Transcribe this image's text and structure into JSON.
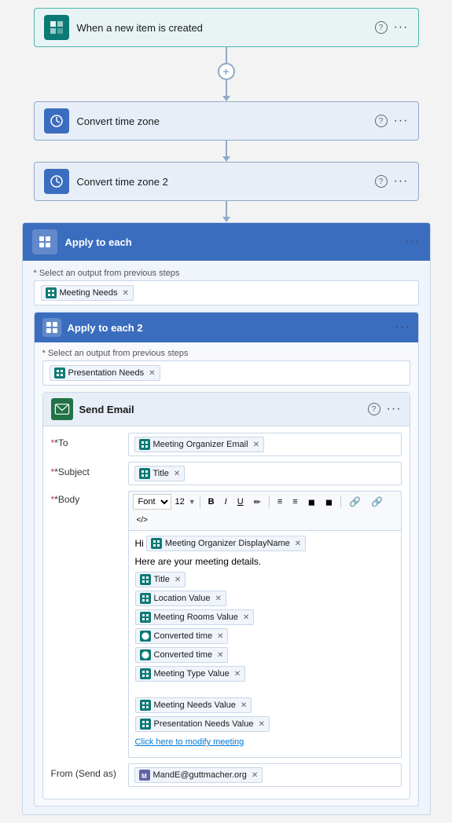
{
  "steps": [
    {
      "id": "trigger",
      "type": "trigger",
      "icon": "sharepoint",
      "label": "When a new item is created"
    },
    {
      "id": "convert-tz-1",
      "type": "action",
      "icon": "clock",
      "label": "Convert time zone"
    },
    {
      "id": "convert-tz-2",
      "type": "action",
      "icon": "clock",
      "label": "Convert time zone 2"
    }
  ],
  "apply_each": {
    "label": "Apply to each",
    "output_label": "* Select an output from previous steps",
    "token": "Meeting Needs",
    "inner": {
      "label": "Apply to each 2",
      "output_label": "* Select an output from previous steps",
      "token": "Presentation Needs",
      "email": {
        "label": "Send Email",
        "help": "?",
        "to_label": "*To",
        "to_token": "Meeting Organizer Email",
        "subject_label": "*Subject",
        "subject_token": "Title",
        "body_label": "*Body",
        "toolbar": {
          "font_label": "Font",
          "font_size": "12",
          "buttons": [
            "B",
            "I",
            "U",
            "✏",
            "≡",
            "≡",
            "◼",
            "◼",
            "🔗",
            "🔗",
            "</>"
          ]
        },
        "body_greeting": "Hi",
        "body_organizer_token": "Meeting Organizer DisplayName",
        "body_text1": "Here are your meeting details.",
        "body_tokens": [
          {
            "label": "Title",
            "icon_type": "teal"
          },
          {
            "label": "Location Value",
            "icon_type": "teal"
          },
          {
            "label": "Meeting Rooms Value",
            "icon_type": "teal"
          },
          {
            "label": "Converted time",
            "icon_type": "clock"
          },
          {
            "label": "Converted time",
            "icon_type": "clock"
          },
          {
            "label": "Meeting Type Value",
            "icon_type": "teal"
          },
          {
            "label": "Meeting Needs Value",
            "icon_type": "teal"
          },
          {
            "label": "Presentation Needs Value",
            "icon_type": "teal"
          }
        ],
        "body_link": "Click here to modify meeting",
        "from_label": "From (Send as)",
        "from_token": "MandE@guttmacher.org"
      }
    }
  }
}
